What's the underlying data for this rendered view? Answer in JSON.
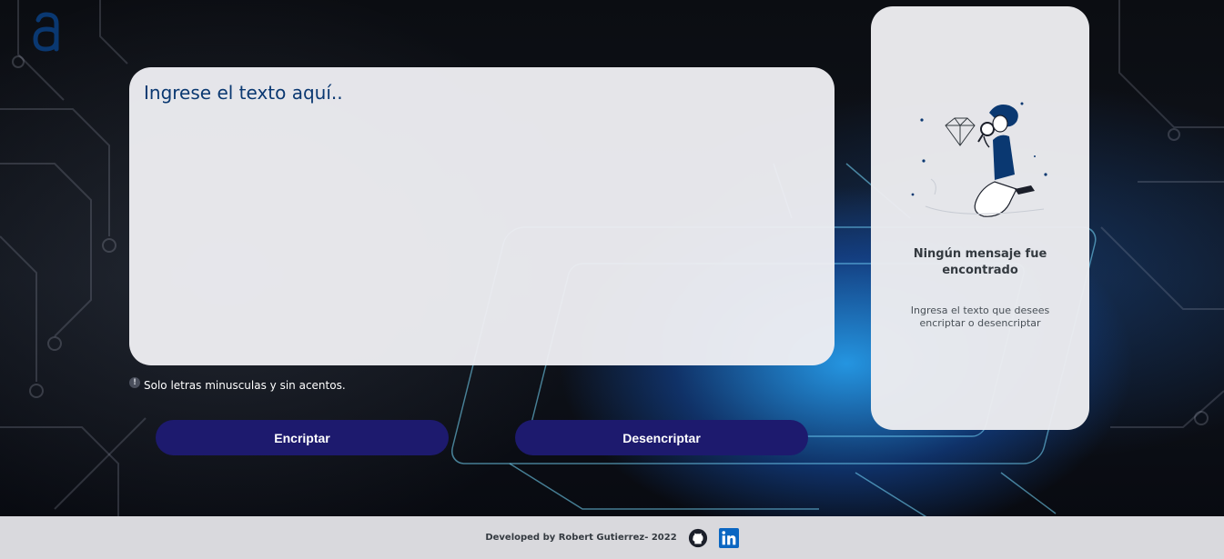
{
  "logo": {
    "icon": "alura-a-logo-icon"
  },
  "input": {
    "placeholder": "Ingrese el texto aquí.."
  },
  "hint": {
    "icon": "info-icon",
    "text": "Solo letras minusculas y sin acentos."
  },
  "buttons": {
    "encrypt": "Encriptar",
    "decrypt": "Desencriptar"
  },
  "output": {
    "illustration": "person-searching-illustration",
    "title": "Ningún mensaje fue encontrado",
    "subtitle": "Ingresa el texto que desees encriptar o desencriptar"
  },
  "footer": {
    "text": "Developed by Robert Gutierrez- 2022",
    "github_icon": "github-icon",
    "linkedin_icon": "linkedin-icon"
  },
  "colors": {
    "brand": "#0a3871",
    "button": "#1d1a6e",
    "card": "#eeeef2",
    "footer": "#d9d9dd"
  }
}
